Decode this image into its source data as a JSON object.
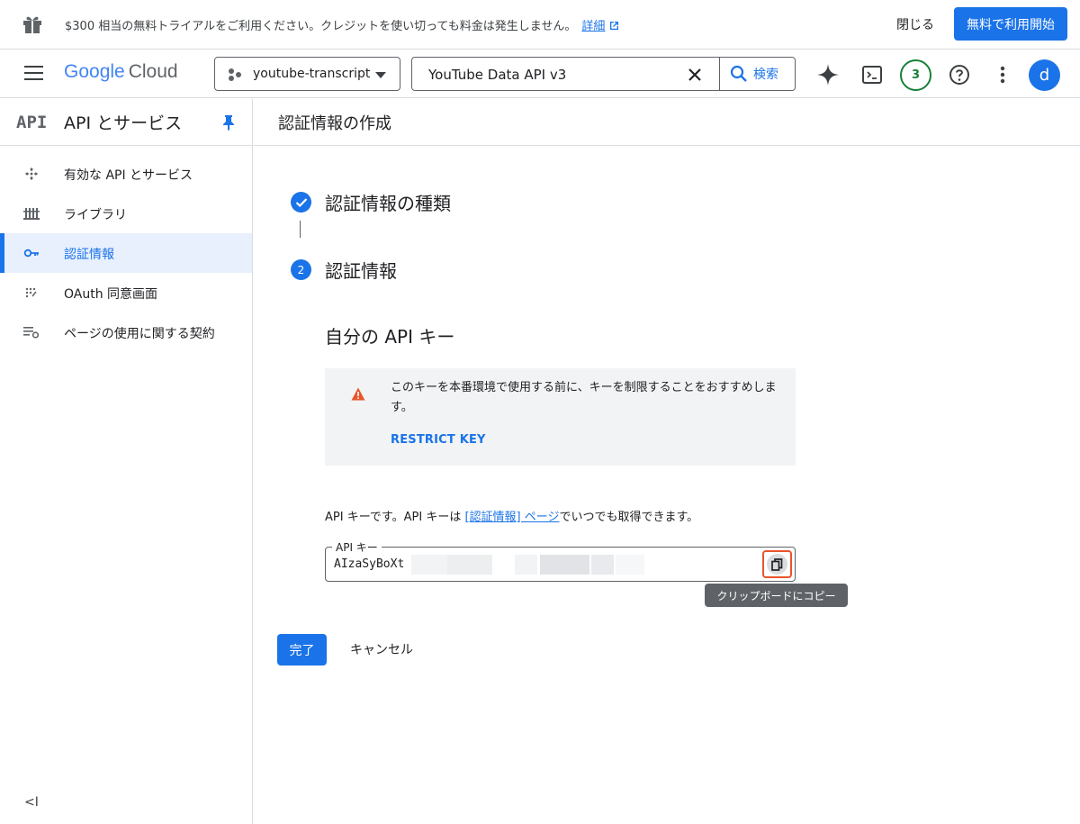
{
  "banner": {
    "text": "$300 相当の無料トライアルをご利用ください。クレジットを使い切っても料金は発生しません。",
    "details_link": "詳細",
    "close_label": "閉じる",
    "start_label": "無料で利用開始"
  },
  "header": {
    "logo_google": "Google",
    "logo_cloud": "Cloud",
    "project_name": "youtube-transcript",
    "search_value": "YouTube Data API v3",
    "search_button": "検索",
    "notification_count": "3",
    "avatar_letter": "d"
  },
  "sidebar": {
    "logo": "API",
    "title": "API とサービス",
    "items": [
      {
        "label": "有効な API とサービス",
        "icon": "services-icon"
      },
      {
        "label": "ライブラリ",
        "icon": "library-icon"
      },
      {
        "label": "認証情報",
        "icon": "key-icon",
        "active": true
      },
      {
        "label": "OAuth 同意画面",
        "icon": "oauth-icon"
      },
      {
        "label": "ページの使用に関する契約",
        "icon": "agreement-icon"
      }
    ],
    "collapse": "<I"
  },
  "main": {
    "page_title": "認証情報の作成",
    "step1_title": "認証情報の種類",
    "step2_number": "2",
    "step2_title": "認証情報",
    "key_heading": "自分の API キー",
    "warning_text": "このキーを本番環境で使用する前に、キーを制限することをおすすめします。",
    "restrict_key": "RESTRICT KEY",
    "info_prefix": "API キーです。API キーは ",
    "info_link": "[認証情報] ページ",
    "info_suffix": "でいつでも取得できます。",
    "key_label": "API キー",
    "key_value": "AIzaSyBoXt",
    "copy_tooltip": "クリップボードにコピー",
    "done_label": "完了",
    "cancel_label": "キャンセル"
  },
  "colors": {
    "accent": "#1a73e8",
    "warning": "#e8552c",
    "badge_green": "#188038"
  }
}
